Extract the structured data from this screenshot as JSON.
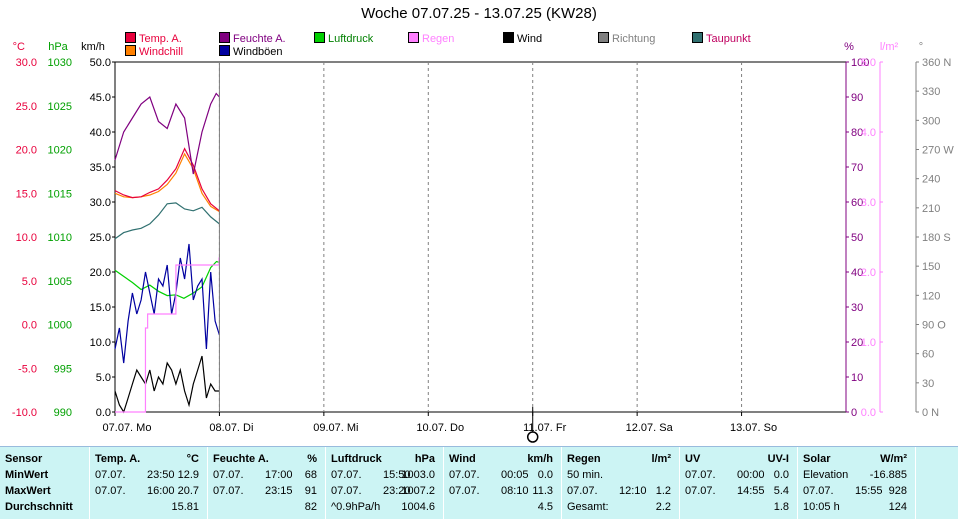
{
  "title": "Woche 07.07.25 - 13.07.25 (KW28)",
  "legend": [
    {
      "label": "Temp. A.",
      "color": "#e8003c"
    },
    {
      "label": "Windchill",
      "color": "#ff8000"
    },
    {
      "label": "Feuchte A.",
      "color": "#800080"
    },
    {
      "label": "Windböen",
      "color": "#0000a0"
    },
    {
      "label": "Luftdruck",
      "color": "#00d000"
    },
    {
      "label": "Regen",
      "color": "#ff80ff"
    },
    {
      "label": "Wind",
      "color": "#000000"
    },
    {
      "label": "Richtung",
      "color": "#808080"
    },
    {
      "label": "Taupunkt",
      "color": "#307070"
    }
  ],
  "axes": {
    "temp": {
      "unit": "°C",
      "ticks": [
        "30.0",
        "25.0",
        "20.0",
        "15.0",
        "10.0",
        "5.0",
        "0.0",
        "-5.0",
        "-10.0"
      ],
      "color": "#e8003c"
    },
    "pressure": {
      "unit": "hPa",
      "ticks": [
        "1030",
        "1025",
        "1020",
        "1015",
        "1010",
        "1005",
        "1000",
        "995",
        "990"
      ],
      "color": "#00a000"
    },
    "wind": {
      "unit": "km/h",
      "ticks": [
        "50.0",
        "45.0",
        "40.0",
        "35.0",
        "30.0",
        "25.0",
        "20.0",
        "15.0",
        "10.0",
        "5.0",
        "0.0"
      ],
      "color": "#000000"
    },
    "humidity": {
      "unit": "%",
      "ticks": [
        "100",
        "90",
        "80",
        "70",
        "60",
        "50",
        "40",
        "30",
        "20",
        "10",
        "0"
      ],
      "color": "#800080"
    },
    "rain": {
      "unit": "l/m²",
      "ticks": [
        "5.0",
        "4.0",
        "3.0",
        "2.0",
        "1.0",
        "0.0"
      ],
      "color": "#ff80ff"
    },
    "direction": {
      "unit": "°",
      "ticks": [
        "360 N",
        "330",
        "300",
        "270 W",
        "240",
        "210",
        "180 S",
        "150",
        "120",
        "90 O",
        "60",
        "30",
        "0 N"
      ],
      "color": "#808080"
    }
  },
  "x_labels": [
    "07.07. Mo",
    "08.07. Di",
    "09.07. Mi",
    "10.07. Do",
    "11.07. Fr",
    "12.07. Sa",
    "13.07. So"
  ],
  "chart_data": {
    "type": "line",
    "title": "Woche 07.07.25 - 13.07.25 (KW28)",
    "x_unit": "hours since 07.07. 00:00",
    "xlim": [
      0,
      168
    ],
    "series": [
      {
        "name": "Temp. A.",
        "axis": "temp",
        "x": [
          0,
          2,
          4,
          6,
          8,
          10,
          12,
          14,
          16,
          18,
          20,
          22,
          24
        ],
        "values": [
          15.3,
          14.8,
          14.5,
          14.6,
          15.1,
          15.5,
          16.5,
          17.8,
          20.1,
          18.2,
          15.5,
          13.8,
          13.0
        ]
      },
      {
        "name": "Windchill",
        "axis": "temp",
        "x": [
          0,
          2,
          4,
          6,
          8,
          10,
          12,
          14,
          16,
          18,
          20,
          22,
          24
        ],
        "values": [
          15.0,
          14.6,
          14.5,
          14.6,
          14.8,
          15.2,
          16.0,
          17.3,
          19.5,
          17.8,
          15.0,
          13.5,
          12.9
        ]
      },
      {
        "name": "Feuchte A.",
        "axis": "humidity",
        "x": [
          0,
          2,
          4,
          6,
          8,
          10,
          12,
          14,
          16,
          18,
          20,
          22,
          23.25,
          24
        ],
        "values": [
          72,
          80,
          84,
          88,
          90,
          83,
          81,
          88,
          84,
          68,
          80,
          88,
          91,
          90
        ]
      },
      {
        "name": "Windböen",
        "axis": "wind",
        "x": [
          0,
          1,
          2,
          3,
          4,
          5,
          6,
          7,
          8,
          9,
          10,
          11,
          12,
          13,
          14,
          15,
          16,
          17,
          18,
          19,
          20,
          21,
          22,
          23,
          24
        ],
        "values": [
          9,
          12,
          7,
          13,
          17,
          14,
          16,
          20,
          17,
          14,
          19,
          18,
          21,
          14,
          17,
          22,
          19,
          24,
          16,
          18,
          19,
          9,
          20,
          13,
          11
        ]
      },
      {
        "name": "Luftdruck",
        "axis": "pressure",
        "x": [
          0,
          2,
          4,
          6,
          8,
          10,
          12,
          14,
          15.83,
          18,
          20,
          22,
          23.33,
          24
        ],
        "values": [
          1006.2,
          1005.5,
          1004.8,
          1004.0,
          1004.5,
          1003.8,
          1003.3,
          1003.4,
          1003.0,
          1003.6,
          1004.3,
          1006.5,
          1007.2,
          1007.1
        ]
      },
      {
        "name": "Wind",
        "axis": "wind",
        "x": [
          0,
          1,
          2,
          3,
          4,
          5,
          6,
          7,
          8,
          9,
          10,
          11,
          12,
          13,
          14,
          15,
          16,
          17,
          18,
          19,
          20,
          21,
          22,
          23,
          24
        ],
        "values": [
          3,
          1,
          0,
          2,
          4,
          6,
          5,
          4,
          6,
          3,
          5,
          4,
          7,
          6,
          4,
          6,
          3,
          1,
          4,
          6,
          8,
          2,
          4,
          3,
          3
        ]
      },
      {
        "name": "Taupunkt",
        "axis": "temp",
        "x": [
          0,
          2,
          4,
          6,
          8,
          10,
          12,
          14,
          16,
          18,
          20,
          22,
          24
        ],
        "values": [
          9.8,
          10.5,
          10.8,
          11.0,
          11.5,
          12.5,
          13.8,
          13.9,
          13.2,
          13.0,
          13.4,
          12.3,
          11.5
        ]
      },
      {
        "name": "Regen",
        "axis": "rain",
        "x": [
          0,
          6.9,
          7.0,
          7.4,
          7.5,
          13.0,
          13.1,
          13.9,
          14.0,
          23.9,
          24
        ],
        "values": [
          0,
          0,
          1.2,
          1.2,
          1.4,
          1.4,
          1.4,
          1.4,
          2.1,
          2.2,
          2.2
        ]
      }
    ],
    "ranges": {
      "temp": [
        -10,
        30
      ],
      "pressure": [
        990,
        1030
      ],
      "wind": [
        0,
        50
      ],
      "humidity": [
        0,
        100
      ],
      "rain": [
        0,
        5
      ],
      "direction": [
        0,
        360
      ]
    },
    "grid": true
  },
  "stats": {
    "temp": {
      "header": "Temp. A.",
      "unit": "°C",
      "min_date": "07.07.",
      "min_time": "23:50",
      "min": "12.9",
      "max_date": "07.07.",
      "max_time": "16:00",
      "max": "20.7",
      "avg": "15.81"
    },
    "hum": {
      "header": "Feuchte A.",
      "unit": "%",
      "min_date": "07.07.",
      "min_time": "17:00",
      "min": "68",
      "max_date": "07.07.",
      "max_time": "23:15",
      "max": "91",
      "avg": "82"
    },
    "press": {
      "header": "Luftdruck",
      "unit": "hPa",
      "min_date": "07.07.",
      "min_time": "15:50",
      "min": "1003.0",
      "max_date": "07.07.",
      "max_time": "23:20",
      "max": "1007.2",
      "trend": "^0.9hPa/h",
      "avg": "1004.6"
    },
    "wind": {
      "header": "Wind",
      "unit": "km/h",
      "min_date": "07.07.",
      "min_time": "00:05",
      "min": "0.0",
      "max_date": "07.07.",
      "max_time": "08:10",
      "max": "11.3",
      "avg": "4.5"
    },
    "rain": {
      "header": "Regen",
      "unit": "l/m²",
      "r1_label": "50 min.",
      "r1_val": "",
      "r2_date": "07.07.",
      "r2_time": "12:10",
      "r2_val": "1.2",
      "r3_label": "Gesamt:",
      "r3_val": "2.2"
    },
    "uv": {
      "header": "UV",
      "unit": "UV-I",
      "min_date": "07.07.",
      "min_time": "00:00",
      "min": "0.0",
      "max_date": "07.07.",
      "max_time": "14:55",
      "max": "5.4",
      "avg": "1.8"
    },
    "solar": {
      "header": "Solar",
      "unit": "W/m²",
      "r1_label": "Elevation",
      "r1_val": "-16.885",
      "r2_date": "07.07.",
      "r2_time": "15:55",
      "r2_val": "928",
      "r3_label": "10:05 h",
      "r3_val": "124"
    },
    "labels": {
      "sensor": "Sensor",
      "min": "MinWert",
      "max": "MaxWert",
      "avg": "Durchschnitt"
    }
  }
}
